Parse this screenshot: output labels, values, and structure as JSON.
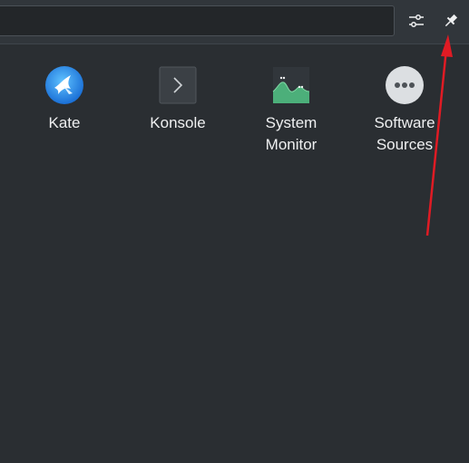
{
  "search": {
    "value": "",
    "placeholder": ""
  },
  "toolbar": {
    "configure_icon": "sliders-icon",
    "pin_icon": "pin-icon"
  },
  "apps": [
    {
      "label": "Kate",
      "icon": "kate-icon"
    },
    {
      "label": "Konsole",
      "icon": "konsole-icon"
    },
    {
      "label": "System\nMonitor",
      "icon": "system-monitor-icon"
    },
    {
      "label": "Software\nSources",
      "icon": "software-sources-icon"
    }
  ],
  "annotation": {
    "color": "#e01b24",
    "points_to": "pin-button"
  },
  "colors": {
    "background": "#2a2e32",
    "topbar": "#31363b",
    "text": "#eff0f1"
  }
}
